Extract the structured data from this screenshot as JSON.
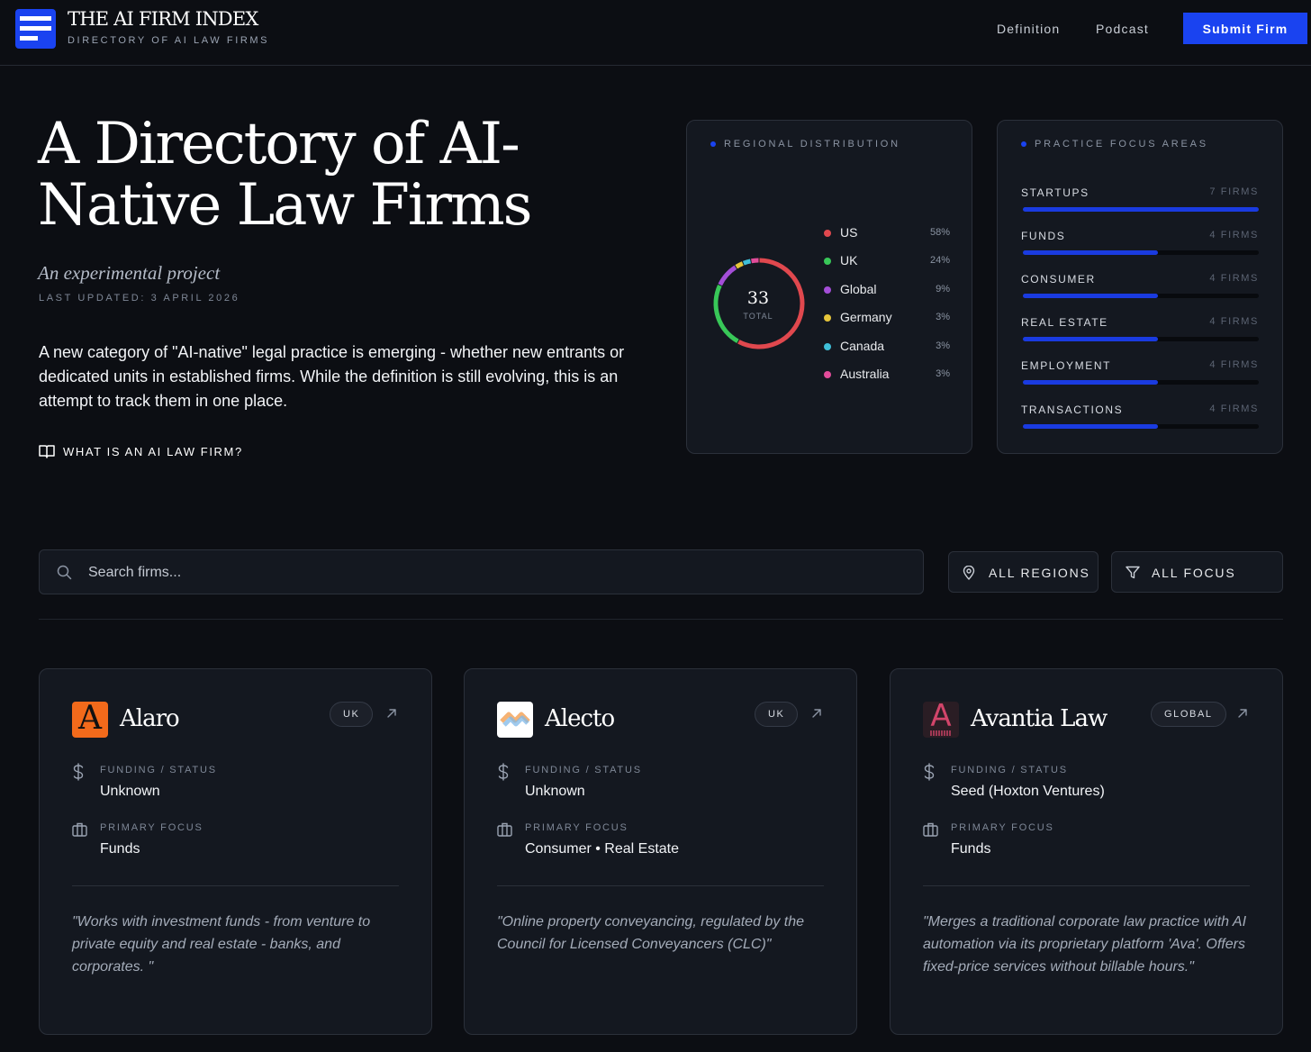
{
  "header": {
    "title": "THE AI FIRM INDEX",
    "subtitle": "DIRECTORY OF AI LAW FIRMS",
    "nav": [
      "Definition",
      "Podcast"
    ],
    "submit_label": "Submit Firm",
    "accent": "#1a43f0"
  },
  "hero": {
    "title_line1": "A Directory of AI-",
    "title_line2": "Native Law Firms",
    "tagline": "An experimental project",
    "updated": "LAST UPDATED: 3 APRIL 2026",
    "description": "A new category of \"AI-native\" legal practice is emerging - whether new entrants or dedicated units in established firms. While the definition is still evolving, this is an attempt to track them in one place.",
    "link_label": "WHAT IS AN AI LAW FIRM?",
    "link_icon": "book-icon"
  },
  "regional": {
    "label": "REGIONAL DISTRIBUTION",
    "total": "33",
    "total_label": "TOTAL",
    "regions": [
      {
        "name": "US",
        "pct": "58%",
        "share": 0.58,
        "color": "#e0484e"
      },
      {
        "name": "UK",
        "pct": "24%",
        "share": 0.24,
        "color": "#38c758"
      },
      {
        "name": "Global",
        "pct": "9%",
        "share": 0.09,
        "color": "#a44ed8"
      },
      {
        "name": "Germany",
        "pct": "3%",
        "share": 0.03,
        "color": "#e6c53a"
      },
      {
        "name": "Canada",
        "pct": "3%",
        "share": 0.03,
        "color": "#3fbfd8"
      },
      {
        "name": "Australia",
        "pct": "3%",
        "share": 0.03,
        "color": "#e24c9a"
      }
    ]
  },
  "practice": {
    "label": "PRACTICE FOCUS AREAS",
    "areas": [
      {
        "name": "STARTUPS",
        "count": "7 FIRMS",
        "share": 1.0
      },
      {
        "name": "FUNDS",
        "count": "4 FIRMS",
        "share": 0.571
      },
      {
        "name": "CONSUMER",
        "count": "4 FIRMS",
        "share": 0.571
      },
      {
        "name": "REAL ESTATE",
        "count": "4 FIRMS",
        "share": 0.571
      },
      {
        "name": "EMPLOYMENT",
        "count": "4 FIRMS",
        "share": 0.571
      },
      {
        "name": "TRANSACTIONS",
        "count": "4 FIRMS",
        "share": 0.571
      }
    ]
  },
  "filters": {
    "search_placeholder": "Search firms...",
    "regions_label": "ALL REGIONS",
    "focus_label": "ALL FOCUS"
  },
  "labels": {
    "funding": "FUNDING / STATUS",
    "focus": "PRIMARY FOCUS"
  },
  "firms": [
    {
      "name": "Alaro",
      "region": "UK",
      "funding": "Unknown",
      "focus": "Funds",
      "quote": "\"Works with investment funds - from venture to private equity and real estate - banks, and corporates. \"",
      "logo_letter": "A",
      "logo_color": "#f26a1b"
    },
    {
      "name": "Alecto",
      "region": "UK",
      "funding": "Unknown",
      "focus": "Consumer • Real Estate",
      "quote": "\"Online property conveyancing, regulated by the Council for Licensed Conveyancers (CLC)\""
    },
    {
      "name": "Avantia Law",
      "region": "GLOBAL",
      "funding": "Seed (Hoxton Ventures)",
      "focus": "Funds",
      "quote": "\"Merges a traditional corporate law practice with AI automation via its proprietary platform 'Ava'. Offers fixed-price services without billable hours.\"",
      "logo_letter": "A",
      "logo_color": "#c0395a"
    }
  ]
}
